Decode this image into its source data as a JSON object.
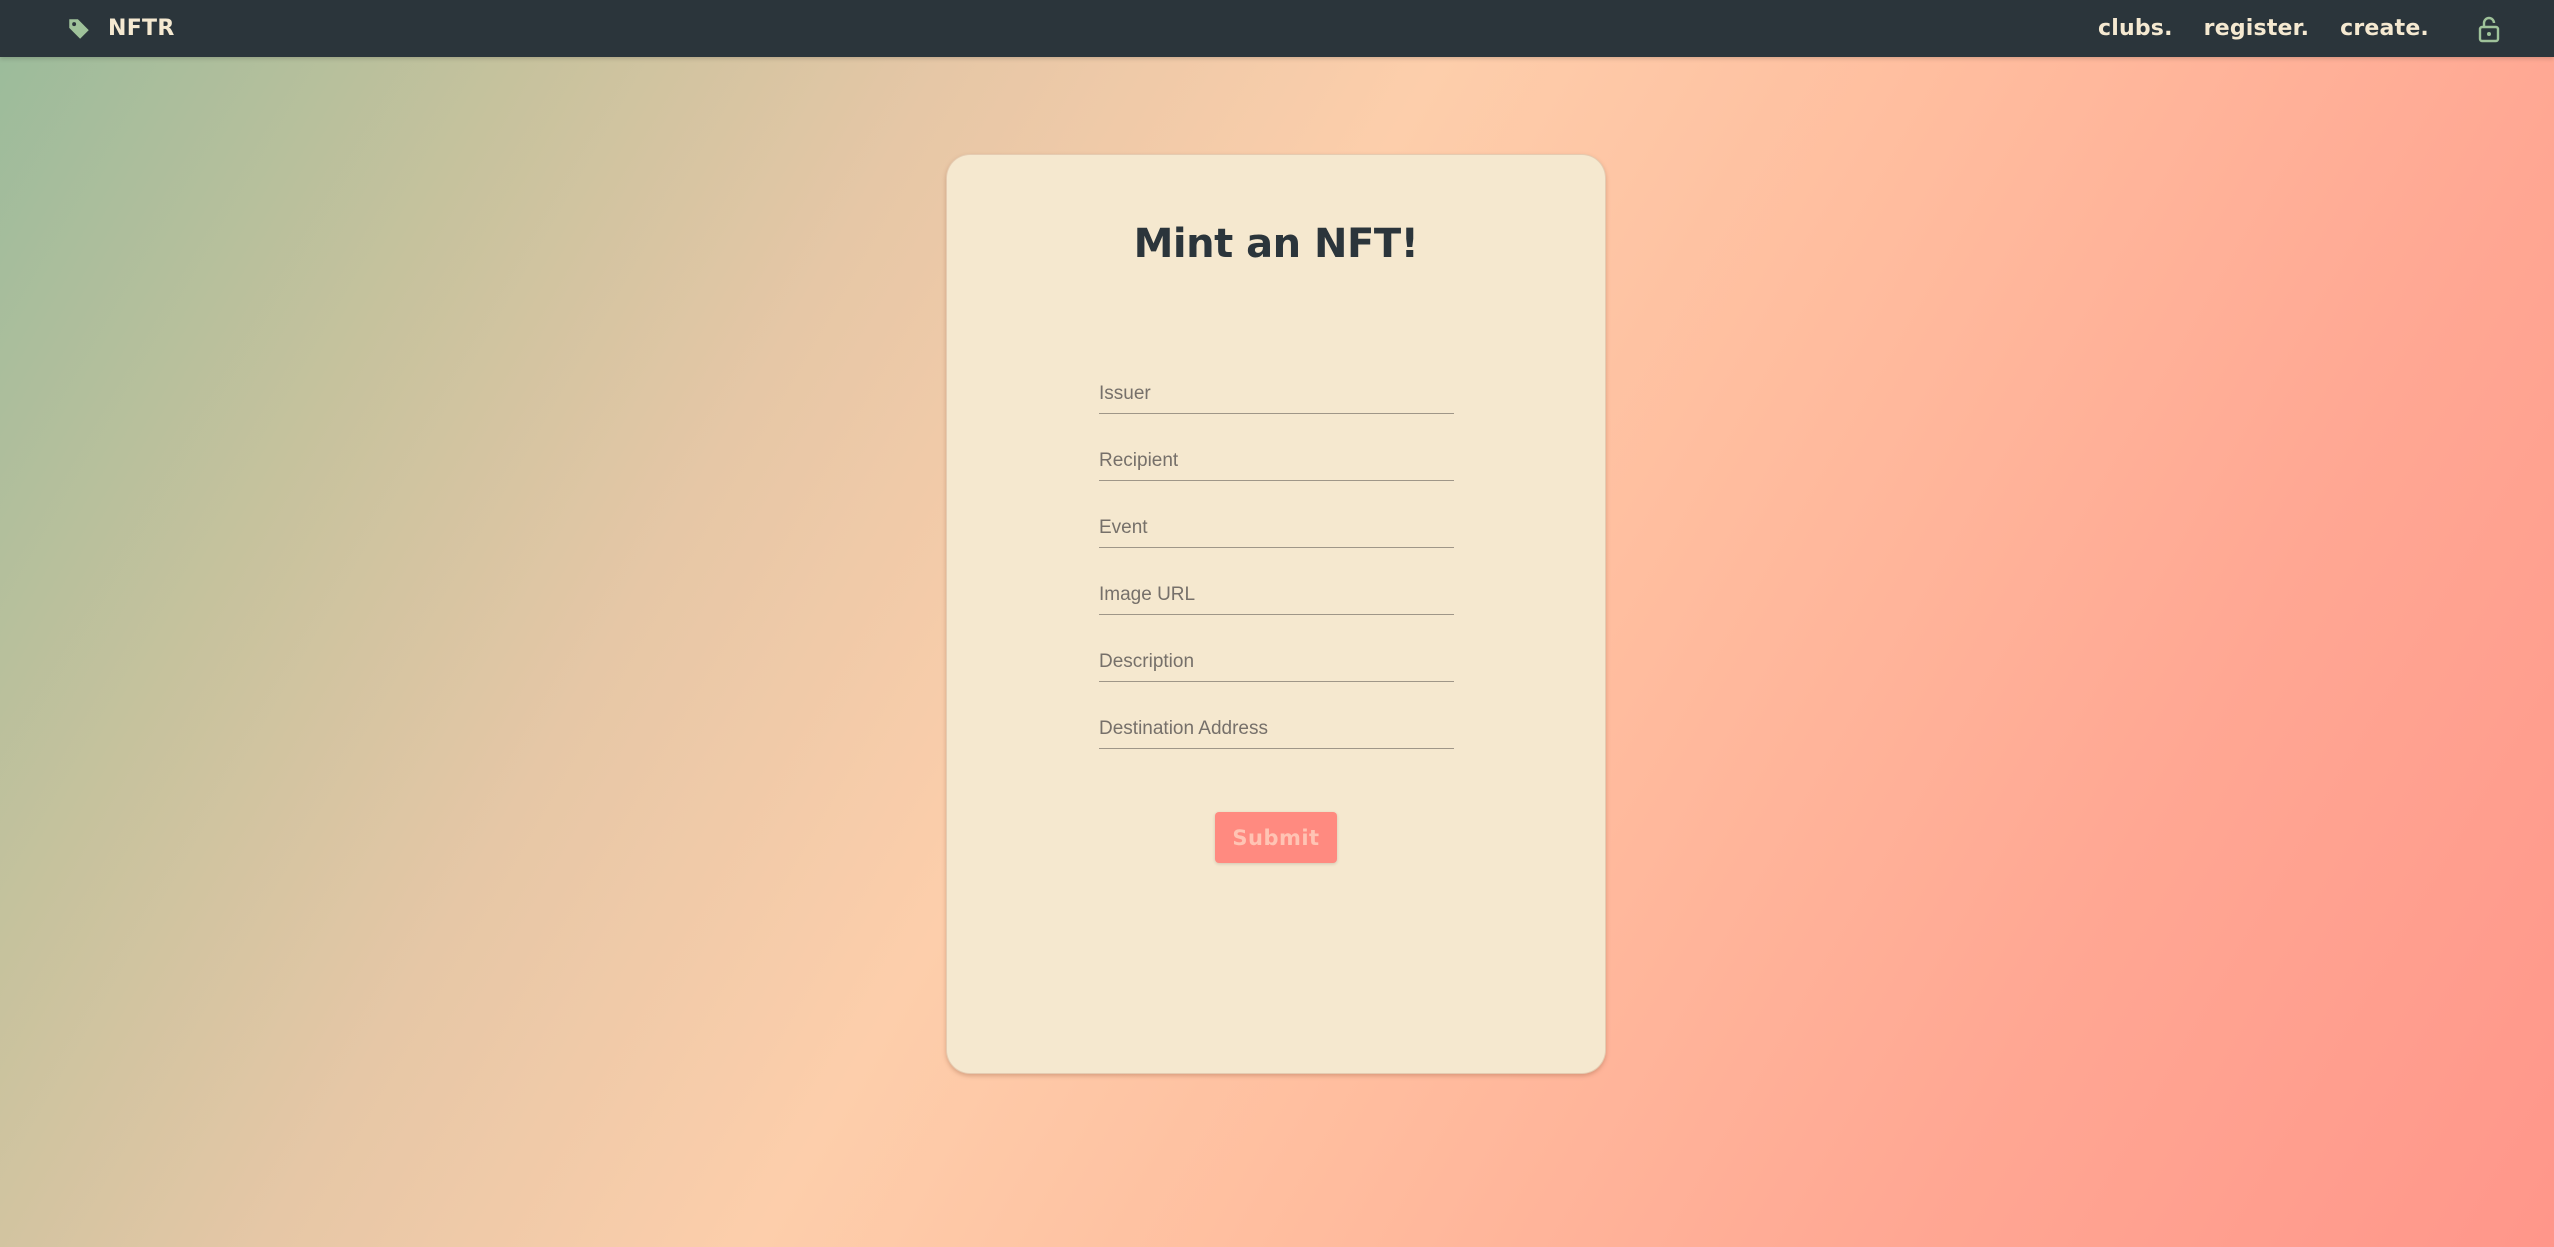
{
  "nav": {
    "brand_icon": "tag-icon",
    "brand": "NFTR",
    "links": [
      "clubs.",
      "register.",
      "create."
    ],
    "lock_icon": "lock-icon"
  },
  "form": {
    "title": "Mint an NFT!",
    "fields": [
      {
        "placeholder": "Issuer",
        "value": ""
      },
      {
        "placeholder": "Recipient",
        "value": ""
      },
      {
        "placeholder": "Event",
        "value": ""
      },
      {
        "placeholder": "Image URL",
        "value": ""
      },
      {
        "placeholder": "Description",
        "value": ""
      },
      {
        "placeholder": "Destination Address",
        "value": ""
      }
    ],
    "submit_label": "Submit"
  },
  "colors": {
    "navbar": "#2b353b",
    "card": "#f5e8cf",
    "accent": "#ff8a80",
    "icon": "#9fc29a"
  }
}
